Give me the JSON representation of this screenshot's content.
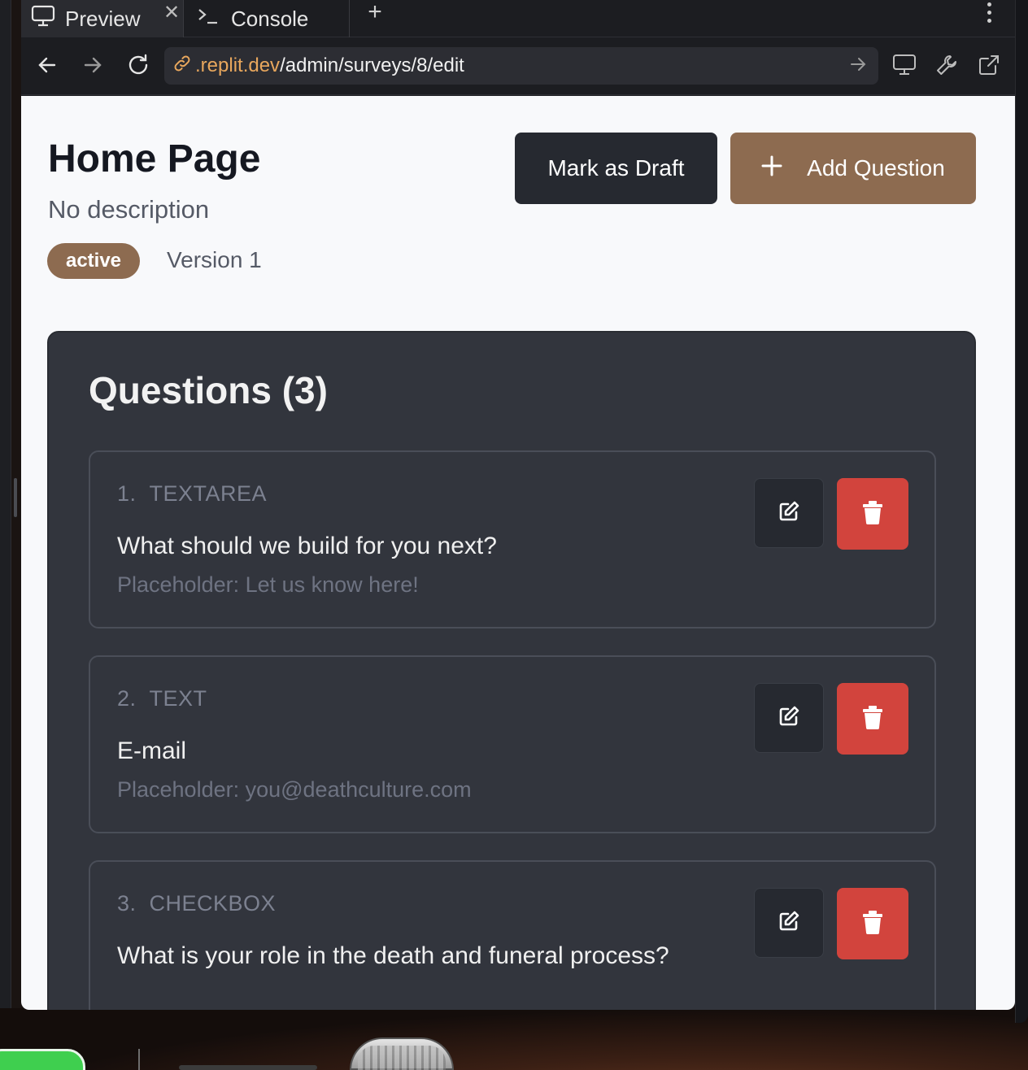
{
  "browser": {
    "tabs": [
      {
        "label": "Preview",
        "icon": "monitor-icon"
      },
      {
        "label": "Console",
        "icon": "terminal-icon"
      }
    ],
    "url": {
      "domain": ".replit.dev",
      "path": "/admin/surveys/8/edit"
    }
  },
  "survey": {
    "title": "Home Page",
    "description": "No description",
    "status": "active",
    "version": "Version 1"
  },
  "actions": {
    "mark_draft_label": "Mark as Draft",
    "add_question_label": "Add Question"
  },
  "questions": {
    "heading": "Questions (3)",
    "items": [
      {
        "number": "1.",
        "type": "TEXTAREA",
        "text": "What should we build for you next?",
        "placeholder": "Placeholder: Let us know here!"
      },
      {
        "number": "2.",
        "type": "TEXT",
        "text": "E-mail",
        "placeholder": "Placeholder: you@deathculture.com"
      },
      {
        "number": "3.",
        "type": "CHECKBOX",
        "text": "What is your role in the death and funeral process?",
        "placeholder": ""
      }
    ]
  },
  "colors": {
    "accent": "#8d6b50",
    "danger": "#d2443d",
    "card": "#32353d",
    "url_domain": "#e8a75d"
  }
}
